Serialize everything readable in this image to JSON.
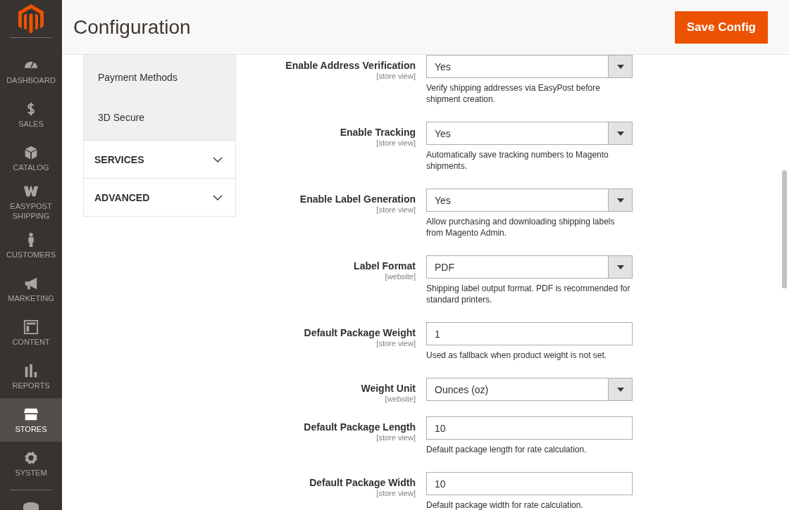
{
  "nav": {
    "items": [
      {
        "label": "DASHBOARD",
        "selected": false
      },
      {
        "label": "SALES",
        "selected": false
      },
      {
        "label": "CATALOG",
        "selected": false
      },
      {
        "label": "EASYPOST SHIPPING",
        "selected": false
      },
      {
        "label": "CUSTOMERS",
        "selected": false
      },
      {
        "label": "MARKETING",
        "selected": false
      },
      {
        "label": "CONTENT",
        "selected": false
      },
      {
        "label": "REPORTS",
        "selected": false
      },
      {
        "label": "STORES",
        "selected": true
      },
      {
        "label": "SYSTEM",
        "selected": false
      }
    ]
  },
  "header": {
    "title": "Configuration",
    "save_button": "Save Config"
  },
  "config_tabs": {
    "sub_items": [
      "Payment Methods",
      "3D Secure"
    ],
    "sections": [
      {
        "label": "SERVICES",
        "expanded": false
      },
      {
        "label": "ADVANCED",
        "expanded": false
      }
    ]
  },
  "fields": [
    {
      "label": "Enable Address Verification",
      "scope": "[store view]",
      "kind": "select",
      "value": "Yes",
      "note": "Verify shipping addresses via EasyPost before shipment creation."
    },
    {
      "label": "Enable Tracking",
      "scope": "[store view]",
      "kind": "select",
      "value": "Yes",
      "note": "Automatically save tracking numbers to Magento shipments."
    },
    {
      "label": "Enable Label Generation",
      "scope": "[store view]",
      "kind": "select",
      "value": "Yes",
      "note": "Allow purchasing and downloading shipping labels from Magento Admin."
    },
    {
      "label": "Label Format",
      "scope": "[website]",
      "kind": "select",
      "value": "PDF",
      "note": "Shipping label output format. PDF is recommended for standard printers."
    },
    {
      "label": "Default Package Weight",
      "scope": "[store view]",
      "kind": "text",
      "value": "1",
      "note": "Used as fallback when product weight is not set."
    },
    {
      "label": "Weight Unit",
      "scope": "[website]",
      "kind": "select",
      "value": "Ounces (oz)"
    },
    {
      "label": "Default Package Length",
      "scope": "[store view]",
      "kind": "text",
      "value": "10",
      "note": "Default package length for rate calculation."
    },
    {
      "label": "Default Package Width",
      "scope": "[store view]",
      "kind": "text",
      "value": "10",
      "note": "Default package width for rate calculation."
    }
  ]
}
